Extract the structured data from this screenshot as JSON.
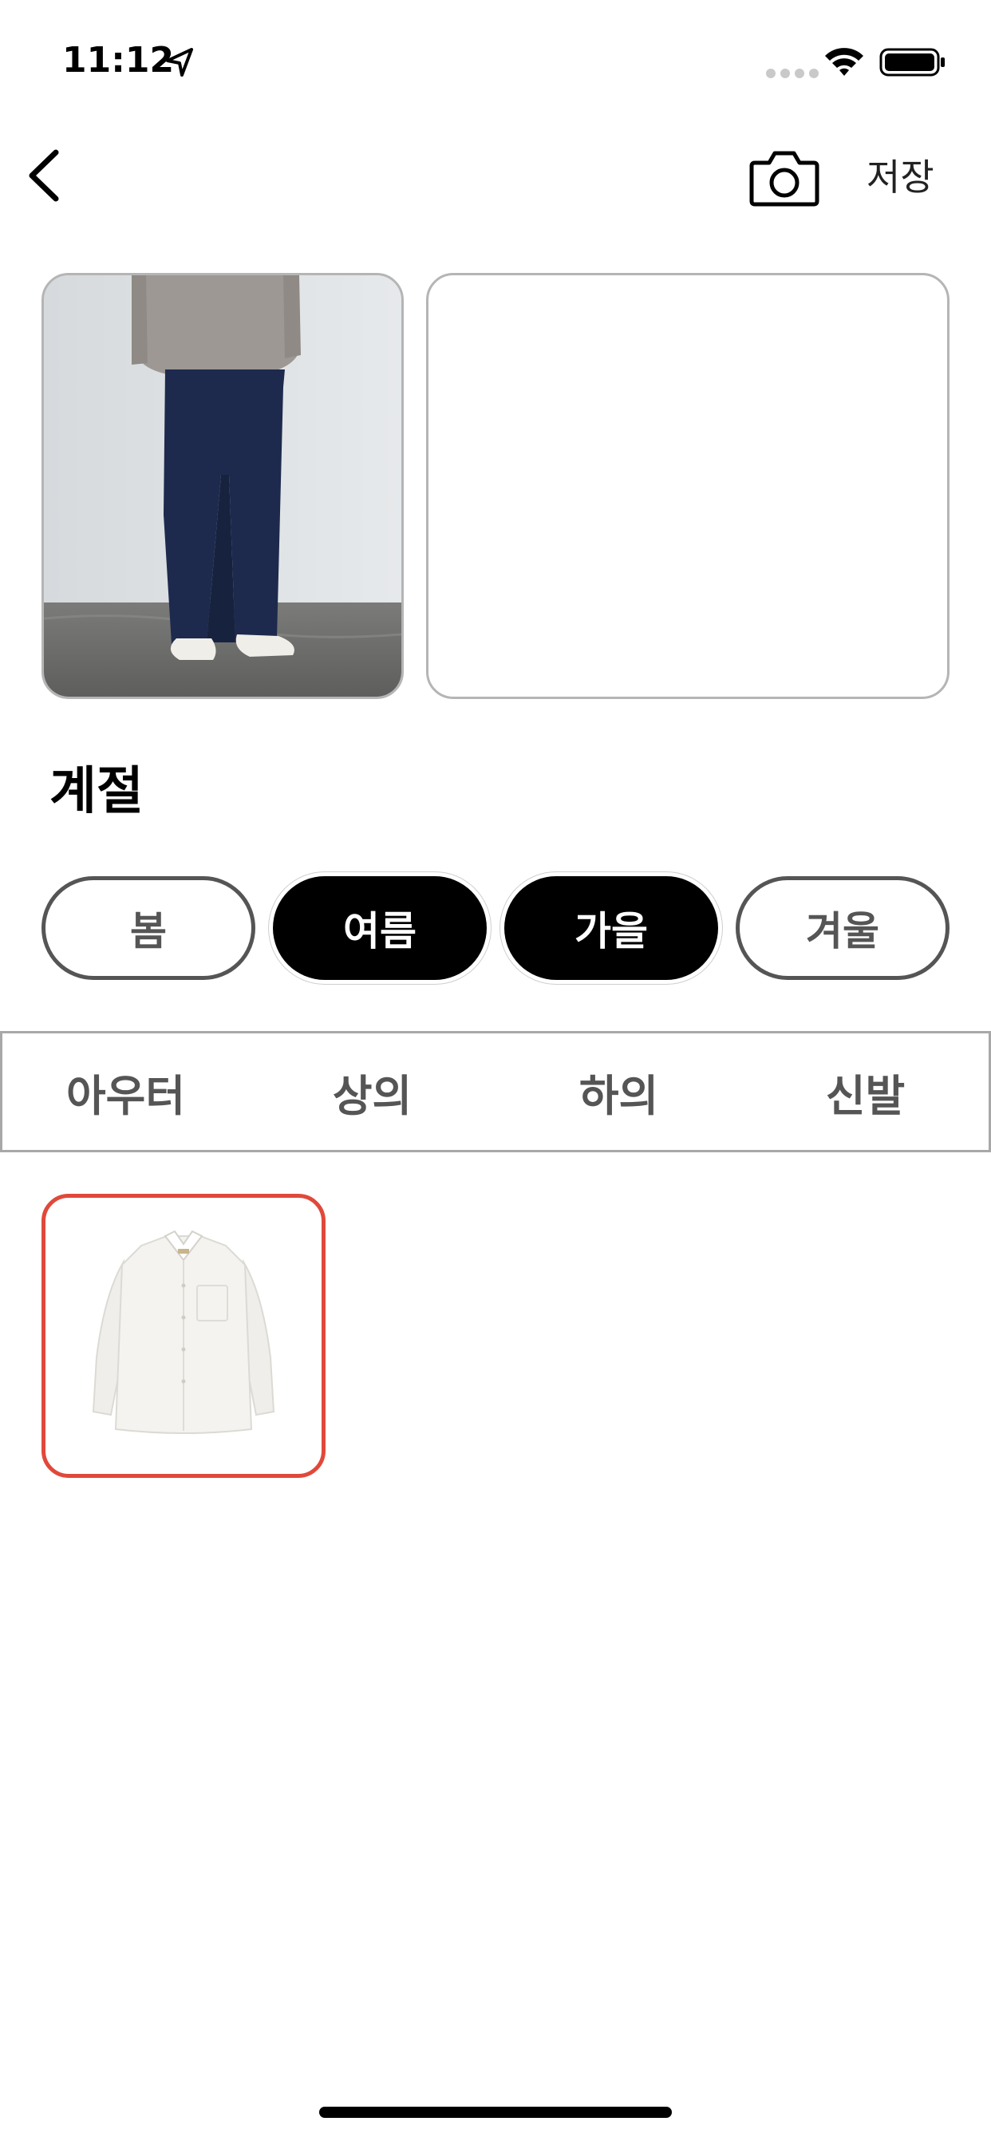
{
  "status_bar": {
    "time": "11:12",
    "location_icon": "location-arrow-icon",
    "signal_icon": "signal-dots-icon",
    "wifi_icon": "wifi-icon",
    "battery_icon": "battery-icon"
  },
  "nav": {
    "back_icon": "chevron-left-icon",
    "camera_icon": "camera-icon",
    "save_label": "저장"
  },
  "images": {
    "main_photo": "person-in-dark-jeans-photo",
    "second_slot": ""
  },
  "season": {
    "title": "계절",
    "chips": [
      {
        "label": "봄",
        "selected": false
      },
      {
        "label": "여름",
        "selected": true
      },
      {
        "label": "가을",
        "selected": true
      },
      {
        "label": "겨울",
        "selected": false
      }
    ]
  },
  "categories": {
    "tabs": [
      {
        "label": "아우터"
      },
      {
        "label": "상의"
      },
      {
        "label": "하의"
      },
      {
        "label": "신발"
      }
    ]
  },
  "items": [
    {
      "image": "white-shirt-thumbnail",
      "selected": true
    }
  ],
  "colors": {
    "accent_selected_border": "#e0493a",
    "chip_on_bg": "#000000",
    "chip_off_border": "#555555"
  }
}
